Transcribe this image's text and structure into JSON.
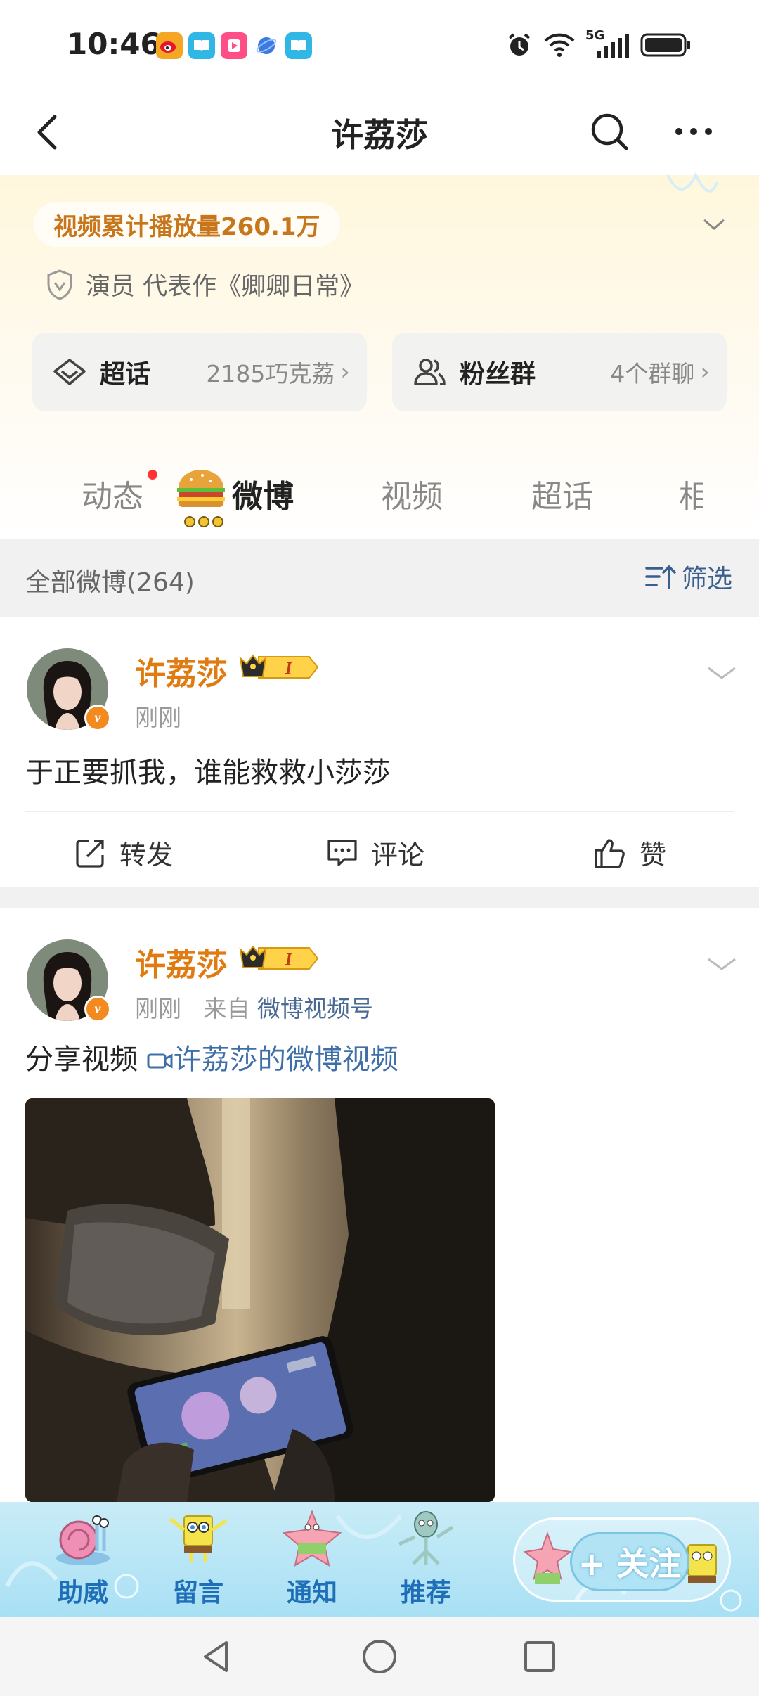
{
  "status_bar": {
    "time": "10:46",
    "network": "5G",
    "apps": [
      {
        "name": "weibo-app-icon",
        "color": "#f5a623"
      },
      {
        "name": "book-app-icon",
        "color": "#31b7e6"
      },
      {
        "name": "video-app-icon",
        "color": "#ff4f86"
      },
      {
        "name": "browser-app-icon",
        "color": "#3a7be0"
      },
      {
        "name": "reader-app-icon",
        "color": "#31b7e6"
      }
    ]
  },
  "nav": {
    "title": "许荔莎"
  },
  "profile": {
    "views_stat": "视频累计播放量260.1万",
    "role": "演员 代表作《卿卿日常》",
    "cards": [
      {
        "name": "超话",
        "value": "2185巧克荔",
        "arrow": "›"
      },
      {
        "name": "粉丝群",
        "value": "4个群聊",
        "arrow": "›"
      }
    ]
  },
  "tabs": {
    "items": [
      "动态",
      "微博",
      "视频",
      "超话",
      "相"
    ],
    "active": "微博"
  },
  "filter": {
    "count": "全部微博(264)",
    "button": "筛选"
  },
  "posts": [
    {
      "username": "许荔莎",
      "crown_level": "I",
      "time": "刚刚",
      "source_prefix": "",
      "source": "",
      "text": "于正要抓我，谁能救救小莎莎",
      "actions": {
        "repost": "转发",
        "comment": "评论",
        "like": "赞"
      }
    },
    {
      "username": "许荔莎",
      "crown_level": "I",
      "time": "刚刚",
      "source_prefix": "来自",
      "source": "微博视频号",
      "text": "分享视频",
      "link": "许荔莎的微博视频"
    }
  ],
  "toolbar": {
    "items": [
      "助威",
      "留言",
      "通知",
      "推荐"
    ],
    "follow": "+ 关注",
    "accent": "#1f6fb8"
  },
  "colors": {
    "username": "#e07b12",
    "link": "#3f6fa8",
    "views": "#c8761c"
  }
}
